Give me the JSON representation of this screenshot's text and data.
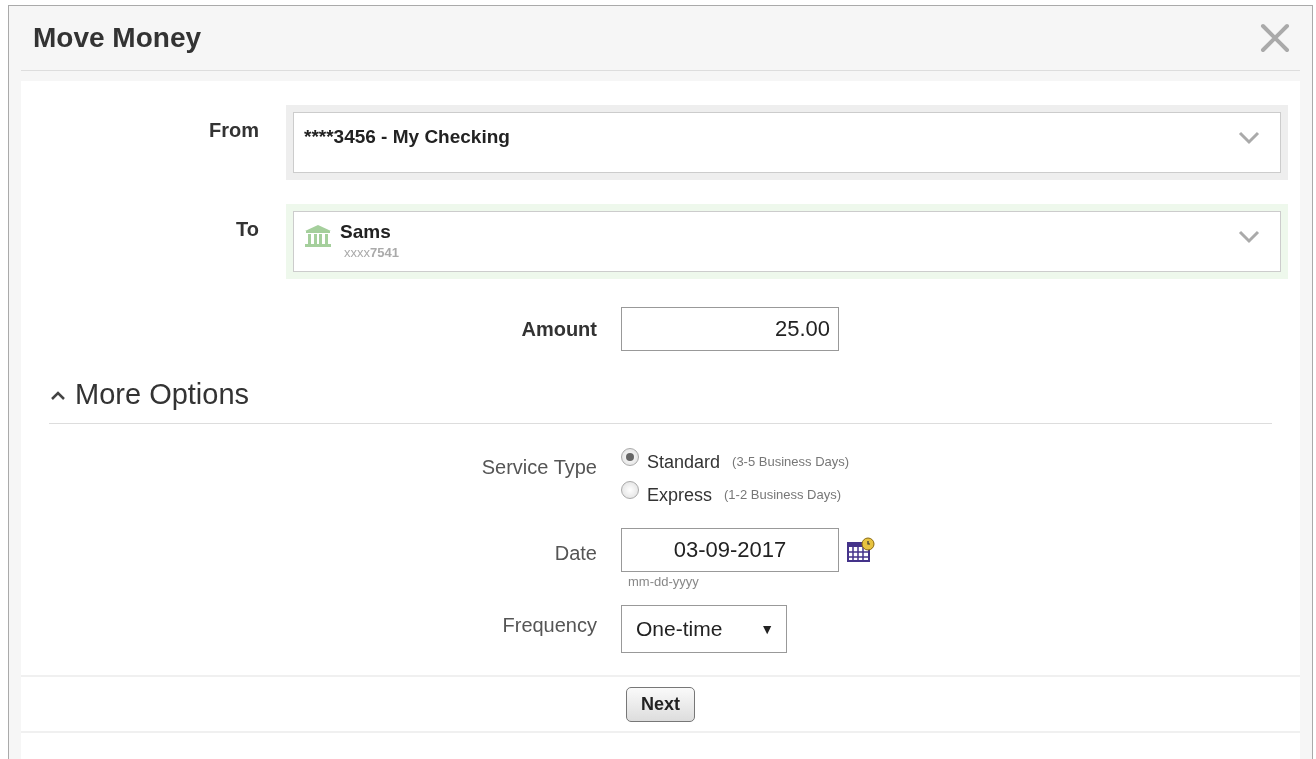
{
  "dialog": {
    "title": "Move Money"
  },
  "from": {
    "label": "From",
    "value": "****3456 - My Checking"
  },
  "to": {
    "label": "To",
    "name": "Sams",
    "account": "xxxx**7541**"
  },
  "amount": {
    "label": "Amount",
    "value": "25.00"
  },
  "more_options": {
    "label": "More Options",
    "expanded": true
  },
  "service_type": {
    "label": "Service Type",
    "options": [
      {
        "label": "Standard",
        "note": "(3-5 Business Days)",
        "selected": true
      },
      {
        "label": "Express",
        "note": "(1-2 Business Days)",
        "selected": false
      }
    ]
  },
  "date": {
    "label": "Date",
    "value": "03-09-2017",
    "hint": "mm-dd-yyyy"
  },
  "frequency": {
    "label": "Frequency",
    "value": "One-time",
    "caret": "▼"
  },
  "buttons": [
    "Next"
  ]
}
